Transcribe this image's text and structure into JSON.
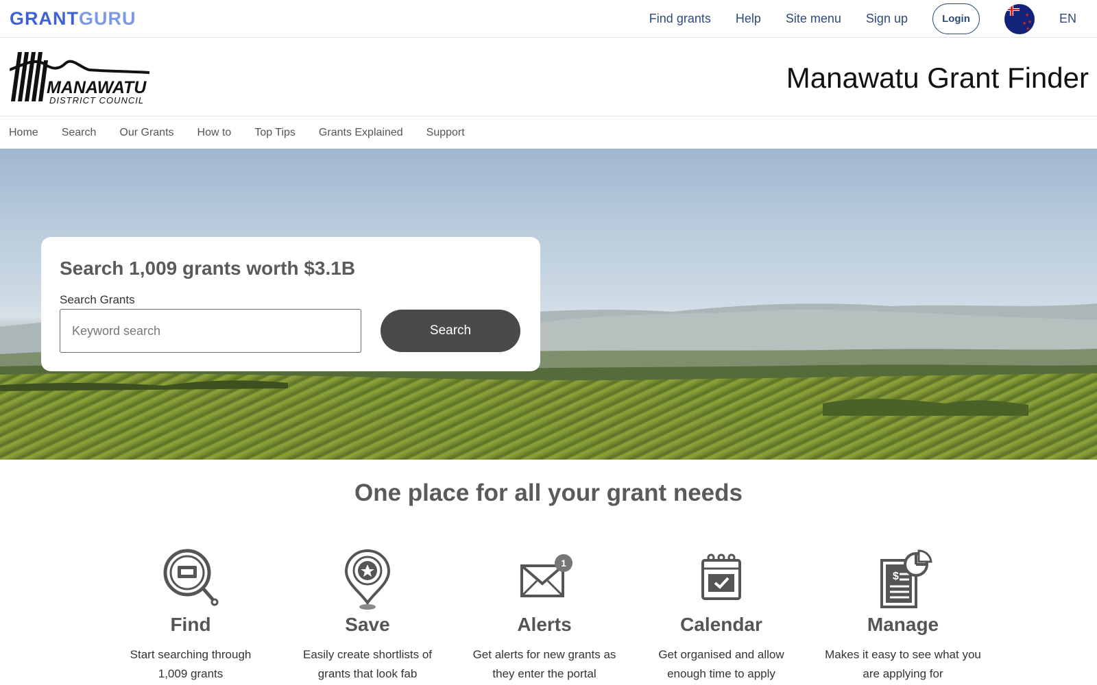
{
  "brand": {
    "part1": "GRANT",
    "part2": "GURU"
  },
  "topnav": {
    "find_grants": "Find grants",
    "help": "Help",
    "site_menu": "Site menu",
    "sign_up": "Sign up",
    "login": "Login",
    "language": "EN"
  },
  "council": {
    "logo_name": "MANAWATU",
    "logo_sub": "DISTRICT  COUNCIL",
    "title": "Manawatu Grant Finder"
  },
  "subnav": [
    "Home",
    "Search",
    "Our Grants",
    "How to",
    "Top Tips",
    "Grants Explained",
    "Support"
  ],
  "search": {
    "heading": "Search 1,009 grants worth $3.1B",
    "label": "Search Grants",
    "placeholder": "Keyword search",
    "button": "Search"
  },
  "features": {
    "title": "One place for all your grant needs",
    "items": [
      {
        "icon": "magnifier-icon",
        "title": "Find",
        "line1": "Start searching through",
        "line2": "1,009 grants"
      },
      {
        "icon": "location-pin-star-icon",
        "title": "Save",
        "line1": "Easily create shortlists of",
        "line2": "grants that look fab"
      },
      {
        "icon": "envelope-alert-icon",
        "title": "Alerts",
        "line1": "Get alerts for new grants as",
        "line2": "they enter the portal"
      },
      {
        "icon": "calendar-icon",
        "title": "Calendar",
        "line1": "Get organised and allow",
        "line2": "enough time to apply"
      },
      {
        "icon": "document-chart-icon",
        "title": "Manage",
        "line1": "Makes it easy to see what you",
        "line2": "are applying for"
      }
    ],
    "alert_badge": "1"
  },
  "colors": {
    "brand_primary": "#3e62d6",
    "brand_secondary": "#7d98e8",
    "nav_text": "#2d4a7a",
    "search_button": "#4a4a4a"
  }
}
